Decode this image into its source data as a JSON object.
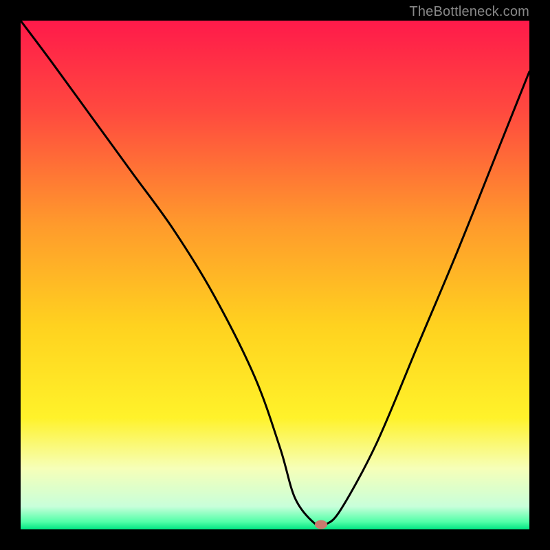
{
  "watermark": "TheBottleneck.com",
  "chart_data": {
    "type": "line",
    "title": "",
    "xlabel": "",
    "ylabel": "",
    "xlim": [
      0,
      100
    ],
    "ylim": [
      0,
      100
    ],
    "gradient_stops": [
      {
        "pos": 0.0,
        "color": "#ff1a4a"
      },
      {
        "pos": 0.18,
        "color": "#ff4a3f"
      },
      {
        "pos": 0.4,
        "color": "#ff9a2c"
      },
      {
        "pos": 0.6,
        "color": "#ffd21f"
      },
      {
        "pos": 0.78,
        "color": "#fff22a"
      },
      {
        "pos": 0.88,
        "color": "#f6ffb8"
      },
      {
        "pos": 0.955,
        "color": "#c8ffda"
      },
      {
        "pos": 0.985,
        "color": "#52ffa8"
      },
      {
        "pos": 1.0,
        "color": "#00e582"
      }
    ],
    "series": [
      {
        "name": "bottleneck-curve",
        "x": [
          0,
          6,
          14,
          22,
          30,
          38,
          46,
          51,
          54,
          58,
          60,
          63,
          70,
          78,
          86,
          94,
          100
        ],
        "y": [
          100,
          92,
          81,
          70,
          59,
          46,
          30,
          16,
          6,
          1,
          1,
          4,
          17,
          36,
          55,
          75,
          90
        ]
      }
    ],
    "marker": {
      "x": 59,
      "y": 1,
      "color": "#c97a6e"
    }
  }
}
